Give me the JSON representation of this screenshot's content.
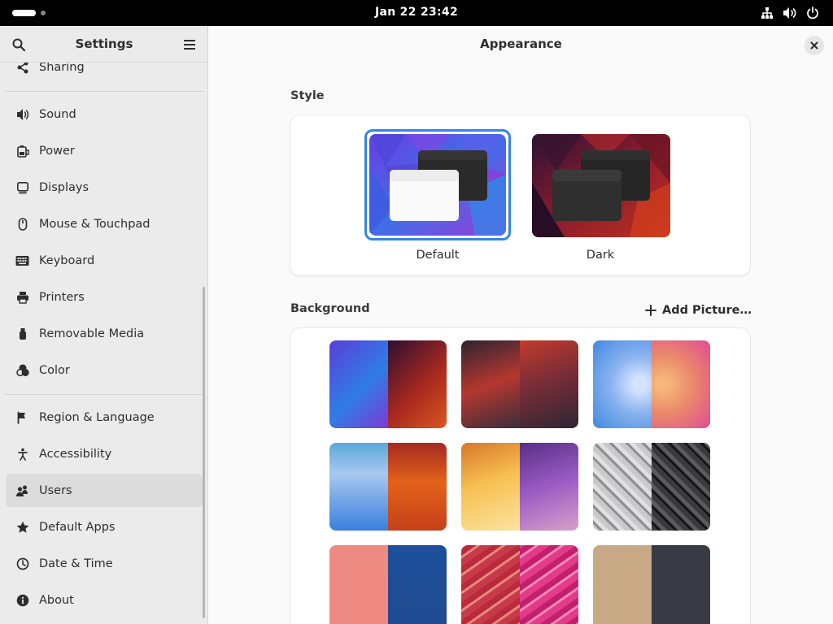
{
  "topbar": {
    "clock": "Jan 22  23:42",
    "icons": [
      "network-wired-icon",
      "volume-icon",
      "power-icon"
    ]
  },
  "sidebar": {
    "title": "Settings",
    "items": [
      {
        "label": "Sharing",
        "icon": "share-icon"
      },
      {
        "label": "Sound",
        "icon": "speaker-icon"
      },
      {
        "label": "Power",
        "icon": "battery-icon"
      },
      {
        "label": "Displays",
        "icon": "display-icon"
      },
      {
        "label": "Mouse & Touchpad",
        "icon": "mouse-icon"
      },
      {
        "label": "Keyboard",
        "icon": "keyboard-icon"
      },
      {
        "label": "Printers",
        "icon": "printer-icon"
      },
      {
        "label": "Removable Media",
        "icon": "usb-drive-icon"
      },
      {
        "label": "Color",
        "icon": "color-icon"
      },
      {
        "label": "Region & Language",
        "icon": "flag-icon"
      },
      {
        "label": "Accessibility",
        "icon": "accessibility-icon"
      },
      {
        "label": "Users",
        "icon": "users-icon"
      },
      {
        "label": "Default Apps",
        "icon": "star-icon"
      },
      {
        "label": "Date & Time",
        "icon": "clock-icon"
      },
      {
        "label": "About",
        "icon": "info-icon"
      }
    ],
    "active": "Users"
  },
  "main": {
    "title": "Appearance",
    "style": {
      "heading": "Style",
      "options": [
        {
          "label": "Default",
          "selected": true
        },
        {
          "label": "Dark",
          "selected": false
        }
      ]
    },
    "background": {
      "heading": "Background",
      "add_label": "Add Picture…"
    }
  },
  "colors": {
    "accent": "#3584e4",
    "sidebar_bg": "#ebebeb",
    "content_bg": "#fafafa",
    "topbar_bg": "#000000"
  }
}
